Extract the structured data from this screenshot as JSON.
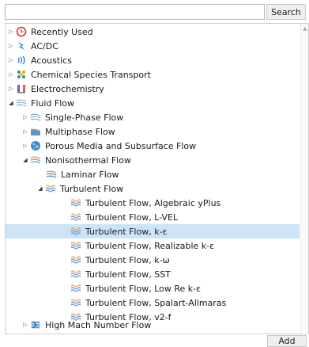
{
  "search": {
    "placeholder": "",
    "value": "",
    "button_label": "Search"
  },
  "tree": {
    "items": [
      {
        "label": "Recently Used",
        "icon": "clock-icon"
      },
      {
        "label": "AC/DC",
        "icon": "lightning-icon"
      },
      {
        "label": "Acoustics",
        "icon": "sound-waves-icon"
      },
      {
        "label": "Chemical Species Transport",
        "icon": "molecules-icon"
      },
      {
        "label": "Electrochemistry",
        "icon": "electrochemistry-icon"
      },
      {
        "label": "Fluid Flow",
        "icon": "flow-icon"
      },
      {
        "label": "Single-Phase Flow",
        "icon": "flow-icon"
      },
      {
        "label": "Multiphase Flow",
        "icon": "multiphase-icon"
      },
      {
        "label": "Porous Media and Subsurface Flow",
        "icon": "porous-media-icon"
      },
      {
        "label": "Nonisothermal Flow",
        "icon": "nonisothermal-flow-icon"
      },
      {
        "label": "Laminar Flow",
        "icon": "laminar-flow-icon"
      },
      {
        "label": "Turbulent Flow",
        "icon": "turbulent-flow-icon"
      },
      {
        "label": "Turbulent Flow, Algebraic yPlus",
        "icon": "turbulent-flow-icon"
      },
      {
        "label": "Turbulent Flow, L-VEL",
        "icon": "turbulent-flow-icon"
      },
      {
        "label": "Turbulent Flow, k-ε",
        "icon": "turbulent-flow-icon"
      },
      {
        "label": "Turbulent Flow, Realizable k-ε",
        "icon": "turbulent-flow-icon"
      },
      {
        "label": "Turbulent Flow, k-ω",
        "icon": "turbulent-flow-icon"
      },
      {
        "label": "Turbulent Flow, SST",
        "icon": "turbulent-flow-icon"
      },
      {
        "label": "Turbulent Flow, Low Re k-ε",
        "icon": "turbulent-flow-icon"
      },
      {
        "label": "Turbulent Flow, Spalart-Allmaras",
        "icon": "turbulent-flow-icon"
      },
      {
        "label": "Turbulent Flow, v2-f",
        "icon": "turbulent-flow-icon"
      },
      {
        "label": "High Mach Number Flow",
        "icon": "high-mach-flow-icon"
      }
    ],
    "selected_label": "Turbulent Flow, k-ε"
  },
  "footer": {
    "add_label": "Add"
  }
}
